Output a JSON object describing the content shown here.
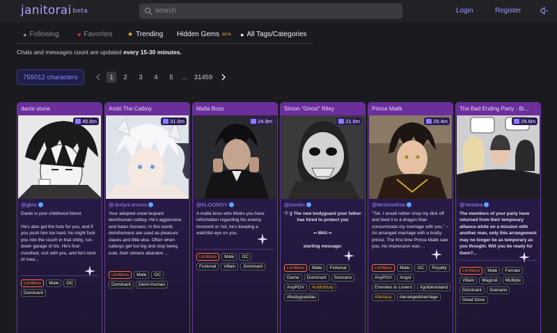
{
  "header": {
    "logo": "janitorai",
    "logo_badge": "beta",
    "search_placeholder": "search",
    "login": "Login",
    "register": "Register"
  },
  "tabs": [
    {
      "label": "Following",
      "icon": "person-icon"
    },
    {
      "label": "Favorites",
      "icon": "heart-icon"
    },
    {
      "label": "Trending",
      "icon": "star-icon",
      "active": true
    },
    {
      "label": "Hidden Gems",
      "badge": "BETA"
    },
    {
      "label": "All Tags/Categories",
      "icon": "circle-icon"
    }
  ],
  "notice": {
    "prefix": "Chats and messages count are updated ",
    "bold": "every 15-30 minutes."
  },
  "character_count": "755012 characters",
  "pagination": {
    "pages": [
      "1",
      "2",
      "3",
      "4",
      "5",
      "...",
      "31459"
    ],
    "current": "1"
  },
  "colors": {
    "accent": "#9b97ff",
    "card_title_bg": "#6b2e9a",
    "limitless_red": "#ff6b5a"
  },
  "cards": [
    {
      "title": "dante stone",
      "count": "45.6m",
      "creator": "@gbro",
      "description": "Dante is your childhood friend.\n\nHe's also got the hots for you, and if you push him too hard, he might fuck you into the couch in that shitty, run-down garage of his. He's foul-mouthed, curt with you, and he's kind of mea...",
      "tags": [
        "Limitless",
        "Male",
        "OC",
        "Dominant"
      ]
    },
    {
      "title": "Andri The Catboy",
      "count": "31.6m",
      "creator": "@Jeslynl.emons",
      "description": "Your adopted snow leopard demihuman catboy. He's aggressive and hates humans; in this world, demihumans are used as pleasure slaves and little else. Often when catboys get too big and stop being cute, their owners abandon ...",
      "tags": [
        "Limitless",
        "Male",
        "OC",
        "Dominant",
        "Demi-Human"
      ]
    },
    {
      "title": "Mafia Boss",
      "count": "24.9m",
      "creator": "@KLOOMSY",
      "description": "A mafia boss who thinks you have information regarding his enemy. Innocent or not, he's keeping a watchful eye on you.",
      "tags": [
        "Limitless",
        "Male",
        "OC",
        "Fictional",
        "Villain",
        "Dominant"
      ]
    },
    {
      "title": "Simon \"Ghost\" Riley",
      "count": "21.6m",
      "creator": "@sereiin",
      "description": "♡ || The new bodyguard your father has hired to protect you\n\n•• M4A ••\n\nstarting message:",
      "tags": [
        "Limitless",
        "Male",
        "Fictional",
        "Game",
        "Dominant",
        "Scenario",
        "AnyPOV",
        "#callofduty",
        "#bodyguardau"
      ]
    },
    {
      "title": "Prince Malik",
      "count": "29.4m",
      "creator": "@Mrshmellow",
      "description": "\"Tsk. I would rather chop my dick off and feed it to a dragon than consummate my marriage with you.\" ~ An arranged marriage with a bratty prince. The first time Prince Malik saw you, his impression was ...",
      "tags": [
        "Limitless",
        "Male",
        "OC",
        "Royalty",
        "AnyPOV",
        "Angst",
        "Enemies to Lovers",
        "#goldenisland",
        "#fantasy",
        "#arrangedmarriage"
      ]
    },
    {
      "title": "The Bad Ending Party - Bi...",
      "count": "29.6m",
      "creator": "@Vestara",
      "description": "The members of your party have returned from their temporary alliance while on a mission with another man, only this arrangement may no longer be as temporary as you thought. Will you be ready for them?...",
      "tags": [
        "Limitless",
        "Male",
        "Female",
        "Villain",
        "Magical",
        "Multiple",
        "Dominant",
        "Scenario",
        "Dead Dove"
      ]
    }
  ]
}
